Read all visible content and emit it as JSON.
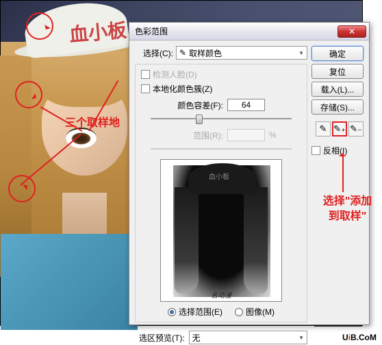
{
  "hat_text": "血小板",
  "annotations": {
    "sample_points": "三个取样地",
    "select_add": "选择\"添加到取样\""
  },
  "dialog": {
    "title": "色彩范围",
    "select_label": "选择(C):",
    "select_value": "取样颜色",
    "detect_faces": "检测人脸(D)",
    "localized": "本地化颜色簇(Z)",
    "fuzziness_label": "颜色容差(F):",
    "fuzziness_value": "64",
    "range_label": "范围(R):",
    "range_unit": "%",
    "radio_selection": "选择范围(E)",
    "radio_image": "图像(M)",
    "preview_label": "选区预览(T):",
    "preview_value": "无",
    "preview_hat_text": "血小板",
    "signature": "名动漫",
    "buttons": {
      "ok": "确定",
      "cancel": "复位",
      "load": "载入(L)...",
      "save": "存储(S)..."
    },
    "invert": "反相(I)"
  },
  "watermark": {
    "u": "U",
    "i": "i",
    "rest": "B.CoM"
  }
}
